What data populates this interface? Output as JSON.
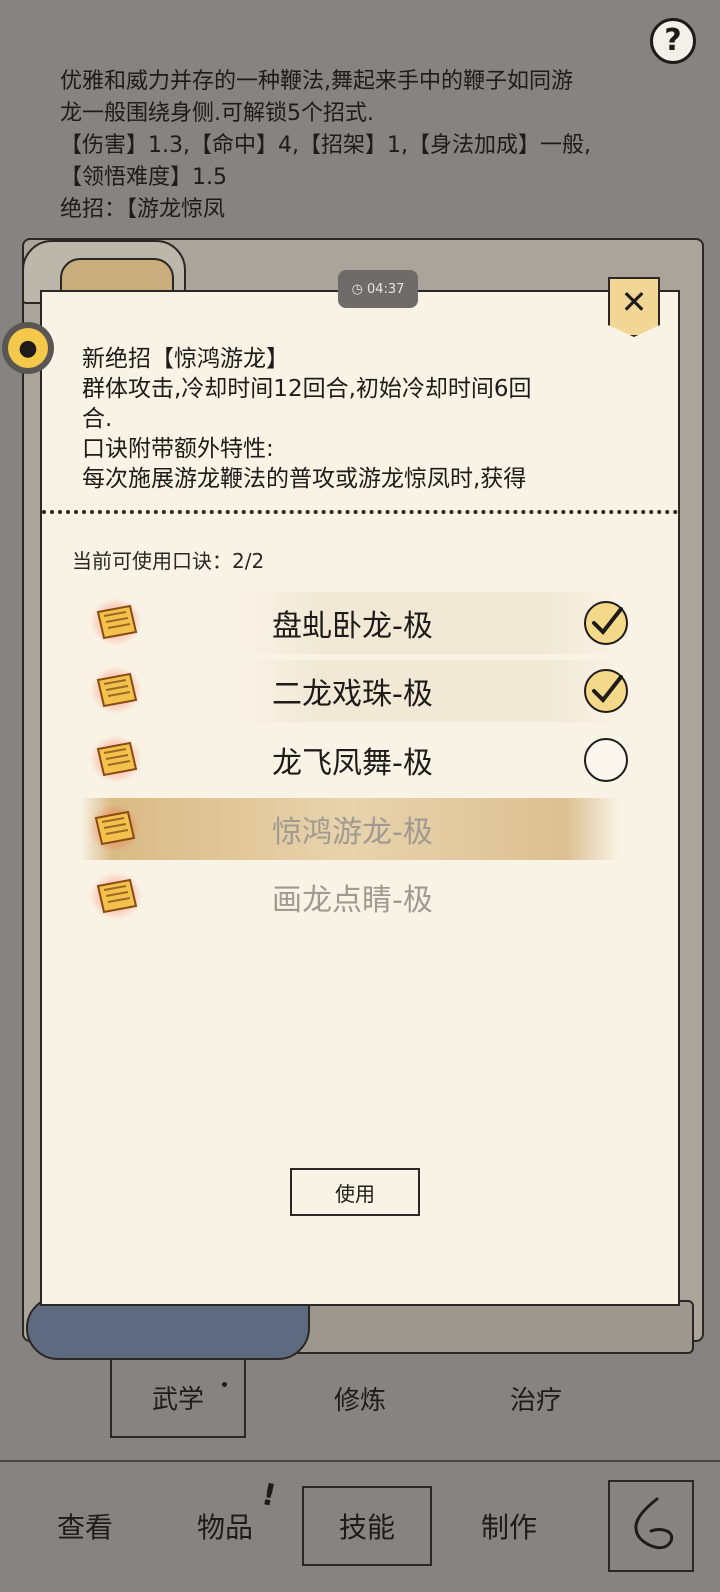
{
  "header": {
    "help_label": "?",
    "desc_lines": [
      "优雅和威力并存的一种鞭法,舞起来手中的鞭子如同游",
      "龙一般围绕身侧.可解锁5个招式.",
      "【伤害】1.3,【命中】4,【招架】1,【身法加成】一般,",
      "【领悟难度】1.5",
      "绝招：【游龙惊凤"
    ]
  },
  "timer": {
    "text": "04:37"
  },
  "dialog": {
    "close_label": "✕",
    "info_lines": [
      "新绝招【惊鸿游龙】",
      "群体攻击,冷却时间12回合,初始冷却时间6回",
      "合.",
      "口诀附带额外特性:",
      "每次施展游龙鞭法的普攻或游龙惊凤时,获得"
    ],
    "count_label": "当前可使用口诀：",
    "count_value": "2/2",
    "items": [
      {
        "label": "盘虬卧龙-极",
        "checked": true,
        "state": "normal"
      },
      {
        "label": "二龙戏珠-极",
        "checked": true,
        "state": "normal"
      },
      {
        "label": "龙飞凤舞-极",
        "checked": false,
        "state": "normal"
      },
      {
        "label": "惊鸿游龙-极",
        "checked": false,
        "state": "highlighted"
      },
      {
        "label": "画龙点睛-极",
        "checked": false,
        "state": "disabled"
      }
    ],
    "use_label": "使用"
  },
  "tabs": {
    "wugong": "武学",
    "xiulian": "修炼",
    "zhiliao": "治疗"
  },
  "nav": {
    "chakan": "查看",
    "wupin": "物品",
    "wupin_mark": "!",
    "jineng": "技能",
    "zhizuo": "制作"
  },
  "colors": {
    "panel_bg": "#f9f3e6",
    "background": "#878380",
    "accent": "#f5d98a"
  }
}
